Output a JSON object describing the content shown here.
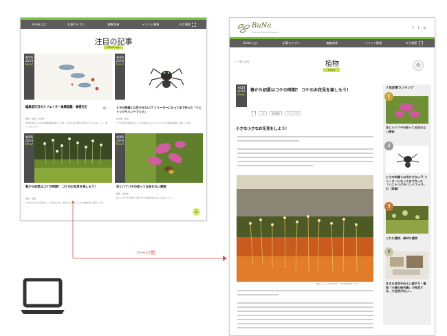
{
  "left_page": {
    "nav": [
      "BuNaとは",
      "記事カテゴリ",
      "編集部便",
      "イベント情報",
      "タグ検索"
    ],
    "section_title": "注目の記事",
    "section_tag": "Close up.",
    "cards": [
      {
        "date": "4/25",
        "year": "2018",
        "badge": "New!",
        "title": "編集部日日のクリエイター魚類図鑑・高橋先生",
        "meta": "植物 · 自然 · 生き物",
        "excerpt": "自然を愛する先生の魚類図鑑を紹介します。水辺の生き物たちをのぞいてみましょう。詳しくはこちら。"
      },
      {
        "date": "4/25",
        "year": "2018",
        "badge": "New!",
        "title": "ヒモの刺繍とは世かせない!? フリーターになってまで作った「ハエトリグモハンドブック」",
        "meta": "生き物 · 研究",
        "excerpt": "クモの世界の魅力をたっぷり詰め込んだハンドブックの制作秘話をご紹介します。"
      },
      {
        "date": "4/25",
        "year": "2018",
        "badge": "New!",
        "title": "春から初夏はコケの時期？ コケのお花見を楽しもう！",
        "meta": "植物 · 自然",
        "excerpt": "小さな小さなお花見をしてみませんか。街中でも出会えるコケの魅力をご紹介します。"
      },
      {
        "date": "4/25",
        "year": "2018",
        "badge": "New!",
        "title": "花とハナバチの知ってる狂わない関係",
        "meta": "植物 · 生き物",
        "excerpt": "花とハナバチの持ちつ持たれつの関係をのぞいてみましょう。"
      }
    ],
    "more_button": "三"
  },
  "arrow_label": "ページ例",
  "right_page": {
    "logo": "BuNa",
    "logo_sub": "Satoyama Nature Magazine",
    "social": [
      "f",
      "t",
      "◎"
    ],
    "nav": [
      "BuNaとは",
      "記事カテゴリ",
      "編集部便",
      "イベント情報",
      "タグ検索"
    ],
    "breadcrumb": "← 一覧へ戻る",
    "category_title": "植物",
    "category_tag": "Plant",
    "article": {
      "date": "4/25",
      "year": "2018",
      "badge": "New!",
      "title": "春から初夏はコケの時期？ コケのお花見を楽しもう！",
      "tags": [
        "コケ",
        "自然観察",
        "フラットデザ"
      ],
      "lead": "小さな小さなお花見をしよう！",
      "photo_caption": "※胞子レトルトのキビで、コケが水をはじいた"
    },
    "sidebar": {
      "heading": "人気記事ランキング",
      "items": [
        {
          "rank": "1",
          "text": "花とハナバチの知ってる狂わない関係"
        },
        {
          "rank": "2",
          "text": "ヒモの刺繍とは世かせない!? フリーターになってまで作った「ハエトリグモハンドブック」の（前編）"
        },
        {
          "rank": "3",
          "text": "これも植物、森林も植物"
        },
        {
          "rank": "4",
          "text": "生きる自然を伝えに越すの・植物「三峰の新刊集」が発見する、大自然が吐い…"
        }
      ]
    }
  },
  "colors": {
    "nav": "#5d5d5d",
    "accent_green": "#7bbf3e",
    "tag_lime": "#c8e05a",
    "arrow": "#d9534f",
    "date_box": "#4d4d4d"
  }
}
